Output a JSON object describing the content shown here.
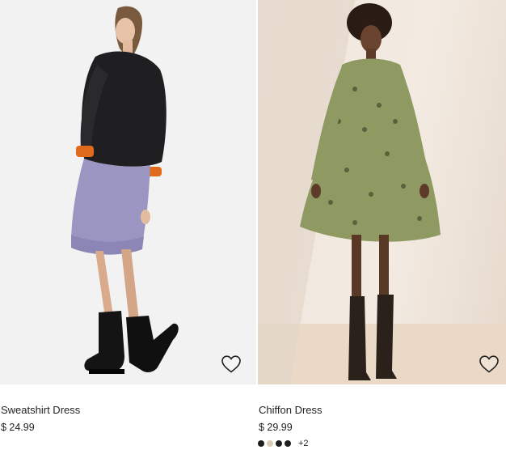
{
  "products": [
    {
      "name": "Sweatshirt Dress",
      "price": "$ 24.99",
      "favorite_icon": "heart-outline-icon",
      "image_alt": "Model wearing a lilac sweatshirt dress with a black bomber jacket and black lace-up boots"
    },
    {
      "name": "Chiffon Dress",
      "price": "$ 29.99",
      "favorite_icon": "heart-outline-icon",
      "image_alt": "Model wearing a green patterned chiffon tiered dress with tall brown boots",
      "swatches": [
        "#1e1e1e",
        "#d8cbb8",
        "#1e1e1e",
        "#1e1e1e"
      ],
      "more_colors": "+2"
    }
  ]
}
